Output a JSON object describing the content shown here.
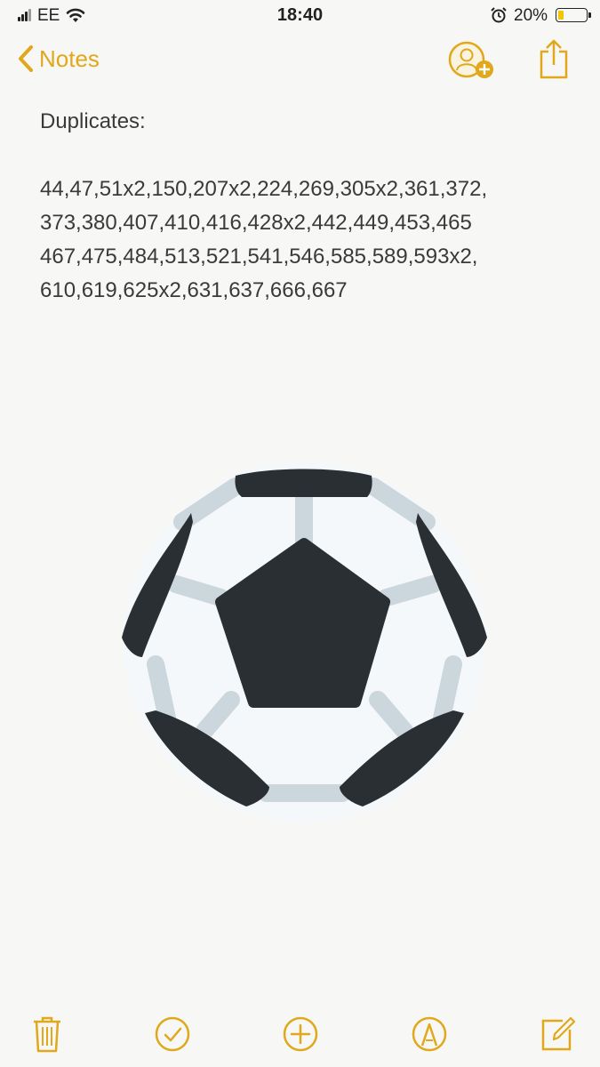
{
  "status_bar": {
    "carrier": "EE",
    "time": "18:40",
    "battery_percent": "20%",
    "battery_level": 0.2,
    "icons": [
      "signal-icon",
      "wifi-icon",
      "alarm-icon",
      "battery-icon"
    ]
  },
  "nav": {
    "back_label": "Notes",
    "icons": [
      "chevron-left-icon",
      "add-person-icon",
      "share-icon"
    ]
  },
  "note": {
    "title": "Duplicates:",
    "lines": [
      "44,47,51x2,150,207x2,224,269,305x2,361,372,",
      "373,380,407,410,416,428x2,442,449,453,465",
      "467,475,484,513,521,541,546,585,589,593x2,",
      "610,619,625x2,631,637,666,667"
    ],
    "image": "soccer-ball-icon"
  },
  "toolbar": {
    "icons": [
      "trash-icon",
      "checklist-icon",
      "add-icon",
      "markup-icon",
      "compose-icon"
    ]
  },
  "colors": {
    "accent": "#e0a81a",
    "background": "#f7f7f5",
    "text": "#3a3a3a",
    "ball_dark": "#292f33",
    "ball_seam": "#ccd6dd",
    "ball_light": "#f5f8fa"
  }
}
